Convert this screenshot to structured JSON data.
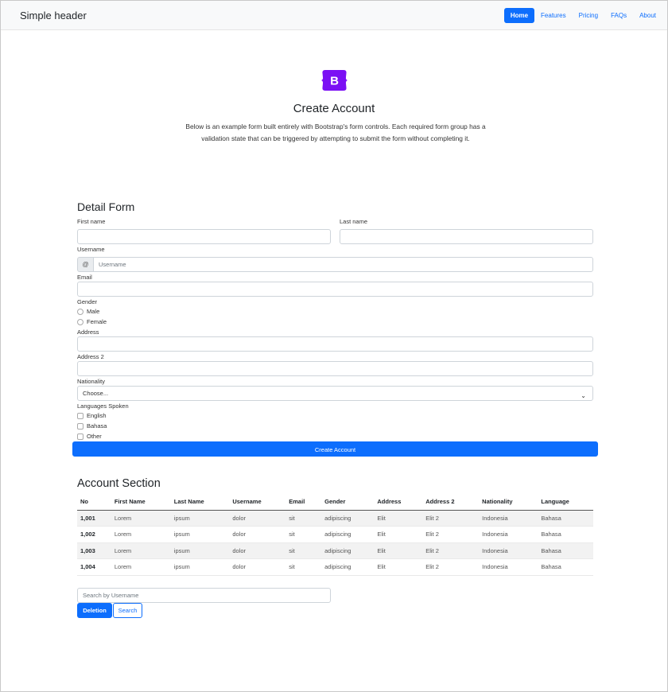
{
  "header": {
    "brand": "Simple header",
    "nav": [
      {
        "label": "Home",
        "active": true
      },
      {
        "label": "Features"
      },
      {
        "label": "Pricing"
      },
      {
        "label": "FAQs"
      },
      {
        "label": "About"
      }
    ]
  },
  "hero": {
    "logo_letter": "B",
    "title": "Create Account",
    "lead": "Below is an example form built entirely with Bootstrap's form controls. Each required form group has a validation state that can be triggered by attempting to submit the form without completing it."
  },
  "colors": {
    "primary": "#0d6efd",
    "logo": "#7b10f4"
  },
  "form": {
    "title": "Detail Form",
    "first_name_label": "First name",
    "last_name_label": "Last name",
    "username_label": "Username",
    "username_addon": "@",
    "username_placeholder": "Username",
    "email_label": "Email",
    "gender_label": "Gender",
    "gender_options": [
      "Male",
      "Female"
    ],
    "address_label": "Address",
    "address2_label": "Address 2",
    "nationality_label": "Nationality",
    "nationality_selected": "Choose...",
    "languages_label": "Languages Spoken",
    "languages": [
      "English",
      "Bahasa",
      "Other"
    ],
    "submit_label": "Create Account"
  },
  "account": {
    "title": "Account Section",
    "columns": [
      "No",
      "First Name",
      "Last Name",
      "Username",
      "Email",
      "Gender",
      "Address",
      "Address 2",
      "Nationality",
      "Language"
    ],
    "rows": [
      [
        "1,001",
        "Lorem",
        "ipsum",
        "dolor",
        "sit",
        "adipiscing",
        "Elit",
        "Elit 2",
        "Indonesia",
        "Bahasa"
      ],
      [
        "1,002",
        "Lorem",
        "ipsum",
        "dolor",
        "sit",
        "adipiscing",
        "Elit",
        "Elit 2",
        "Indonesia",
        "Bahasa"
      ],
      [
        "1,003",
        "Lorem",
        "ipsum",
        "dolor",
        "sit",
        "adipiscing",
        "Elit",
        "Elit 2",
        "Indonesia",
        "Bahasa"
      ],
      [
        "1,004",
        "Lorem",
        "ipsum",
        "dolor",
        "sit",
        "adipiscing",
        "Elit",
        "Elit 2",
        "Indonesia",
        "Bahasa"
      ]
    ],
    "search_placeholder": "Search by Username",
    "delete_label": "Deletion",
    "search_label": "Search"
  }
}
